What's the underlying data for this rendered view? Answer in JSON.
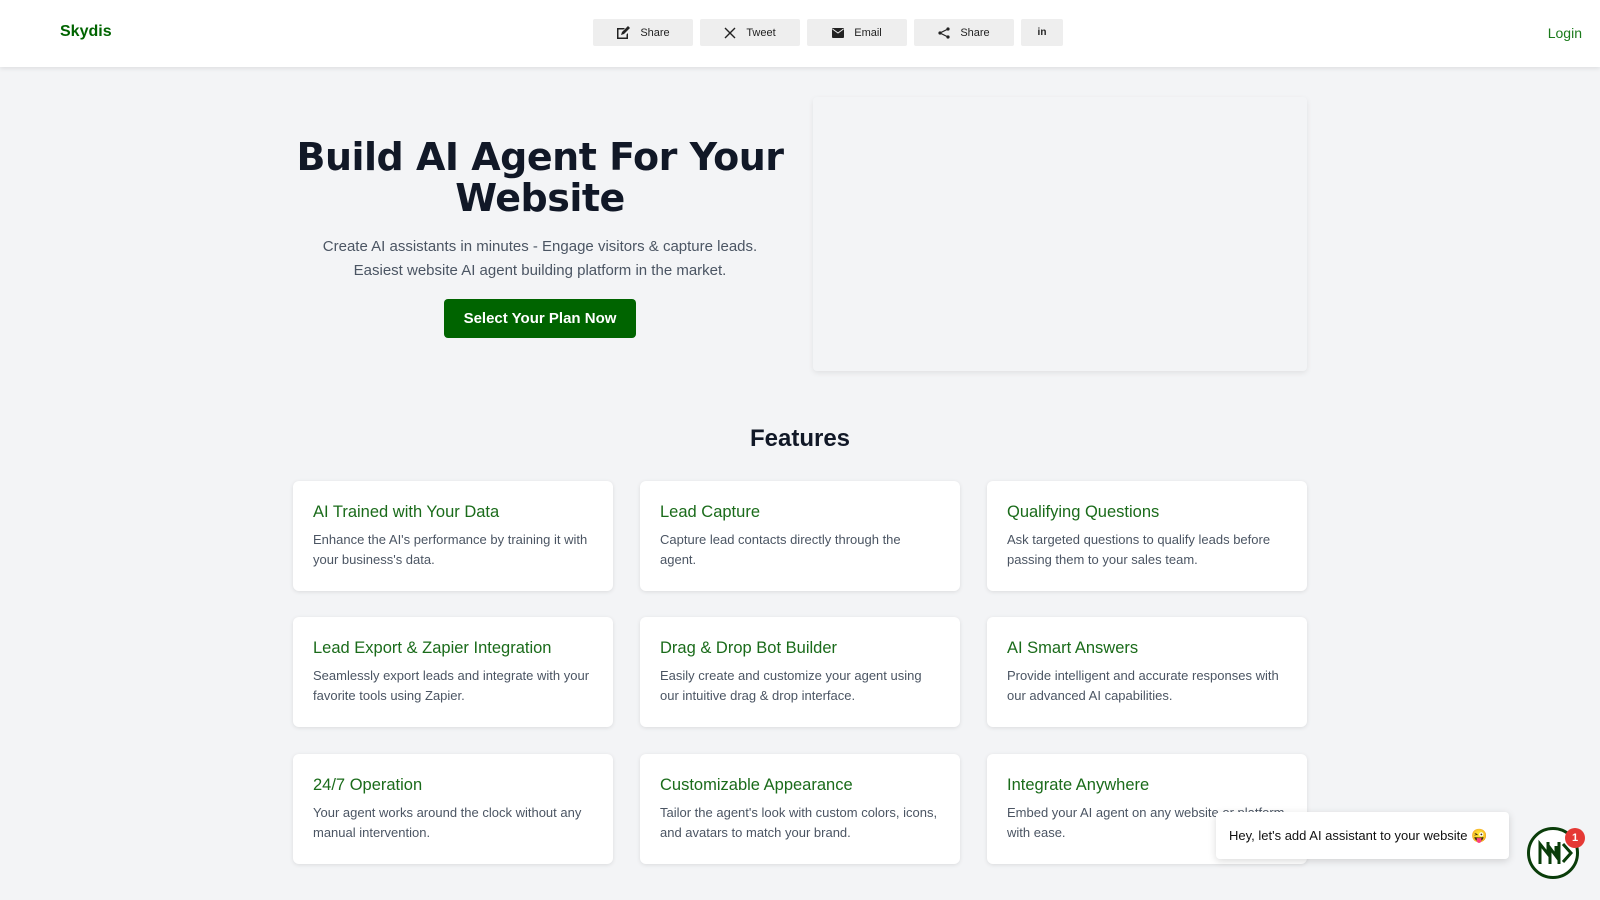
{
  "header": {
    "logo": "Skydis",
    "login": "Login",
    "share_buttons": [
      {
        "label": "Share",
        "icon": "share-pencil-icon"
      },
      {
        "label": "Tweet",
        "icon": "x-icon"
      },
      {
        "label": "Email",
        "icon": "envelope-icon"
      },
      {
        "label": "Share",
        "icon": "share-nodes-icon"
      },
      {
        "label": "in",
        "icon": "linkedin-icon"
      }
    ]
  },
  "hero": {
    "title": "Build AI Agent For Your Website",
    "subtitle": "Create AI assistants in minutes - Engage visitors & capture leads. Easiest website AI agent building platform in the market.",
    "cta": "Select Your Plan Now"
  },
  "features": {
    "title": "Features",
    "items": [
      {
        "title": "AI Trained with Your Data",
        "desc": "Enhance the AI's performance by training it with your business's data."
      },
      {
        "title": "Lead Capture",
        "desc": "Capture lead contacts directly through the agent."
      },
      {
        "title": "Qualifying Questions",
        "desc": "Ask targeted questions to qualify leads before passing them to your sales team."
      },
      {
        "title": "Lead Export & Zapier Integration",
        "desc": "Seamlessly export leads and integrate with your favorite tools using Zapier."
      },
      {
        "title": "Drag & Drop Bot Builder",
        "desc": "Easily create and customize your agent using our intuitive drag & drop interface."
      },
      {
        "title": "AI Smart Answers",
        "desc": "Provide intelligent and accurate responses with our advanced AI capabilities."
      },
      {
        "title": "24/7 Operation",
        "desc": "Your agent works around the clock without any manual intervention."
      },
      {
        "title": "Customizable Appearance",
        "desc": "Tailor the agent's look with custom colors, icons, and avatars to match your brand."
      },
      {
        "title": "Integrate Anywhere",
        "desc": "Embed your AI agent on any website or platform with ease."
      }
    ]
  },
  "chat": {
    "bubble_text": "Hey, let's add AI assistant to your website 😜",
    "badge": "1"
  },
  "colors": {
    "brand_green": "#006400",
    "feature_title_green": "#1a6b1a",
    "badge_red": "#e53935"
  }
}
